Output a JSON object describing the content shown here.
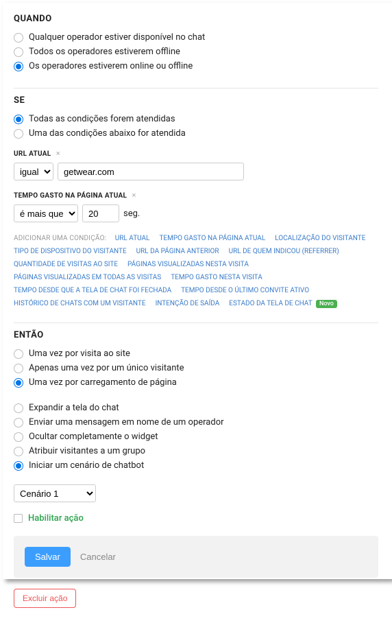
{
  "quando": {
    "title": "QUANDO",
    "options": [
      {
        "label": "Qualquer operador estiver disponível no chat",
        "checked": false
      },
      {
        "label": "Todos os operadores estiverem offline",
        "checked": false
      },
      {
        "label": "Os operadores estiverem online ou offline",
        "checked": true
      }
    ]
  },
  "se": {
    "title": "SE",
    "options": [
      {
        "label": "Todas as condições forem atendidas",
        "checked": true
      },
      {
        "label": "Uma das condições abaixo for atendida",
        "checked": false
      }
    ],
    "url_field": {
      "label": "URL ATUAL",
      "operator_options": [
        "igual"
      ],
      "operator_value": "igual",
      "value": "getwear.com"
    },
    "tempo_field": {
      "label": "TEMPO GASTO NA PÁGINA ATUAL",
      "operator_options": [
        "é mais que"
      ],
      "operator_value": "é mais que",
      "value": "20",
      "suffix": "seg."
    },
    "add_label": "ADICIONAR UMA CONDIÇÃO:",
    "conditions": [
      "URL ATUAL",
      "TEMPO GASTO NA PÁGINA ATUAL",
      "LOCALIZAÇÃO DO VISITANTE",
      "TIPO DE DISPOSITIVO DO VISITANTE",
      "URL DA PÁGINA ANTERIOR",
      "URL DE QUEM INDICOU (REFERRER)",
      "QUANTIDADE DE VISITAS AO SITE",
      "PÁGINAS VISUALIZADAS NESTA VISITA",
      "PÁGINAS VISUALIZADAS EM TODAS AS VISITAS",
      "TEMPO GASTO NESTA VISITA",
      "TEMPO DESDE QUE A TELA DE CHAT FOI FECHADA",
      "TEMPO DESDE O ÚLTIMO CONVITE ATIVO",
      "HISTÓRICO DE CHATS COM UM VISITANTE",
      "INTENÇÃO DE SAÍDA"
    ],
    "last_condition": {
      "label": "ESTADO DA TELA DE CHAT",
      "badge": "Novo"
    }
  },
  "entao": {
    "title": "ENTÃO",
    "freq_options": [
      {
        "label": "Uma vez por visita ao site",
        "checked": false
      },
      {
        "label": "Apenas uma vez por um único visitante",
        "checked": false
      },
      {
        "label": "Uma vez por carregamento de página",
        "checked": true
      }
    ],
    "action_options": [
      {
        "label": "Expandir a tela do chat",
        "checked": false
      },
      {
        "label": "Enviar uma mensagem em nome de um operador",
        "checked": false
      },
      {
        "label": "Ocultar completamente o widget",
        "checked": false
      },
      {
        "label": "Atribuir visitantes a um grupo",
        "checked": false
      },
      {
        "label": "Iniciar um cenário de chatbot",
        "checked": true
      }
    ],
    "scenario_options": [
      "Cenário 1"
    ],
    "scenario_value": "Cenário 1",
    "enable_label": "Habilitar ação"
  },
  "buttons": {
    "save": "Salvar",
    "cancel": "Cancelar",
    "delete": "Excluir ação"
  }
}
